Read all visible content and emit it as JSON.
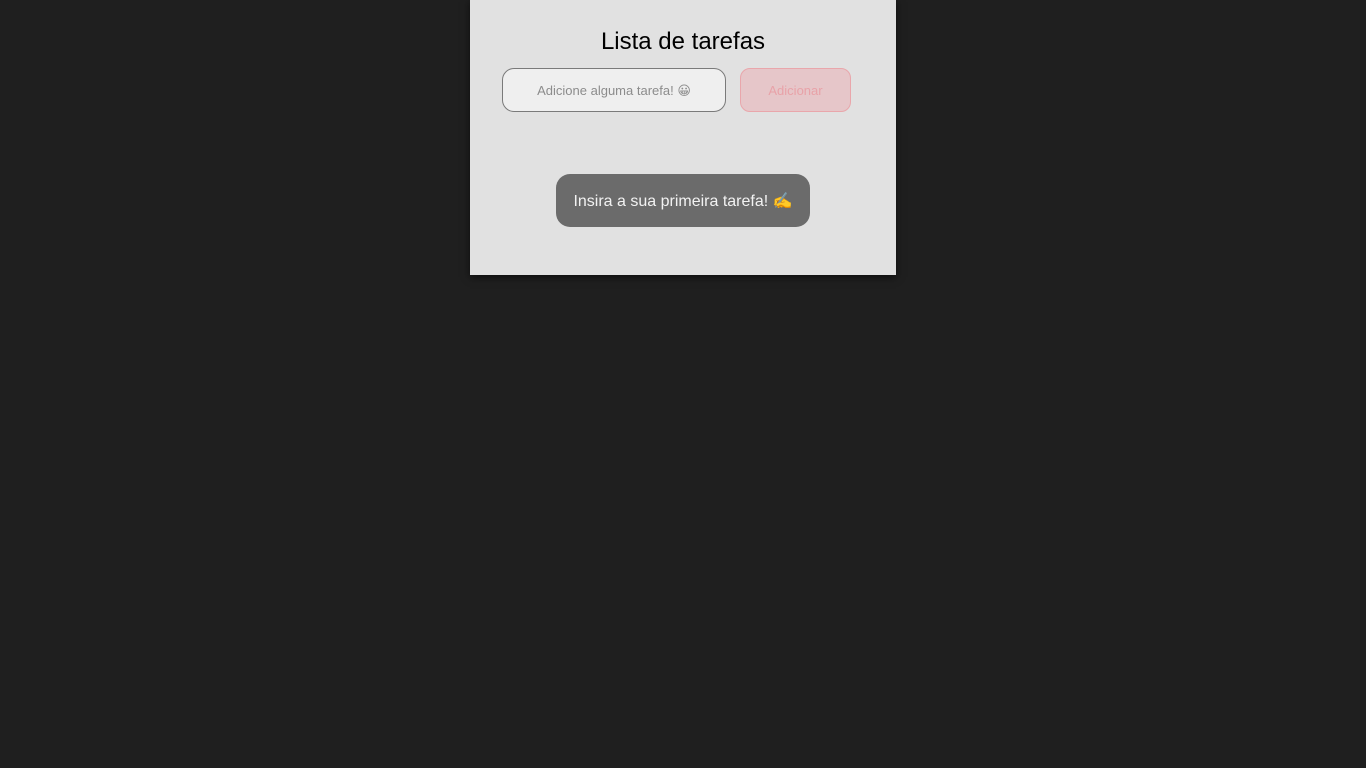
{
  "app": {
    "title": "Lista de tarefas"
  },
  "task_form": {
    "input_value": "",
    "input_placeholder": "Adicione alguma tarefa! 😀",
    "add_button_label": "Adicionar",
    "add_button_disabled": true
  },
  "task_list": {
    "items": [],
    "empty_message": "Insira a sua primeira tarefa! ✍️"
  },
  "colors": {
    "page_background": "#1f1f1f",
    "card_background": "#e1e1e1",
    "add_button_disabled_background": "#e6c6c9",
    "add_button_disabled_text": "#e8a2a8",
    "empty_message_background": "#6b6b6b"
  }
}
